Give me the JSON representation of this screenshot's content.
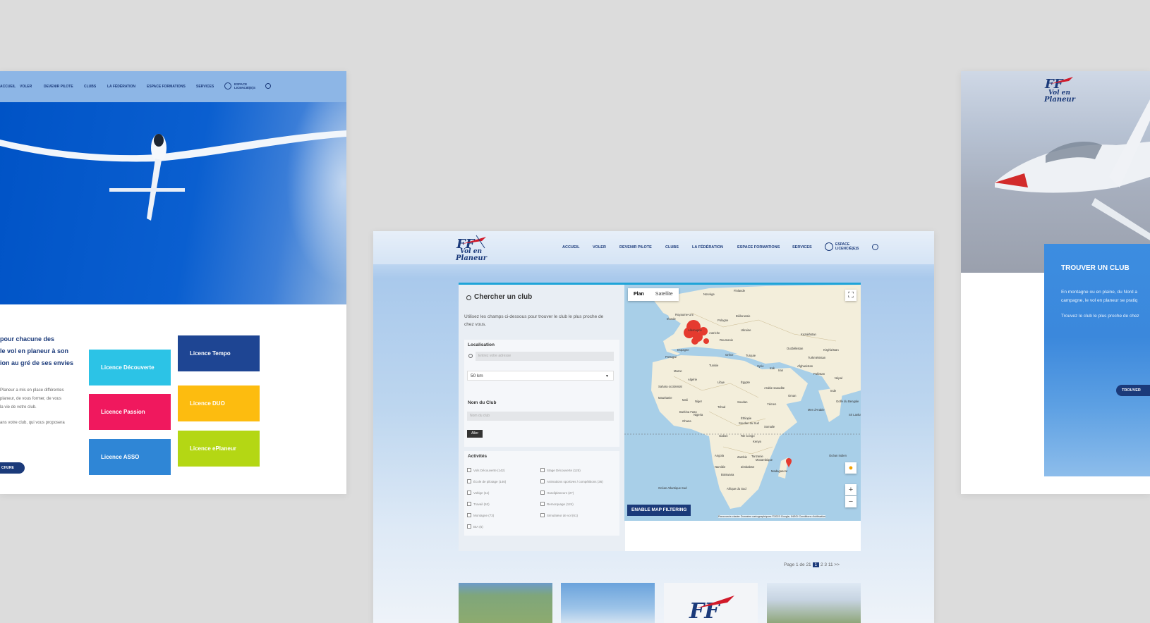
{
  "left": {
    "nav": [
      "ACCUEIL",
      "VOLER",
      "DEVENIR PILOTE",
      "CLUBS",
      "LA FÉDÉRATION",
      "ESPACE FORMATIONS",
      "SERVICES",
      "ESPACE LICENCIÉ(E)S"
    ],
    "intro_lines": [
      "pour chacune des",
      "le vol en planeur à son",
      "ion au gré de ses envies"
    ],
    "small_lines": [
      "Planeur a mis en place différentes",
      "planeur, de vous former, de vous",
      "la vie de votre club.",
      "ans votre club, qui vous proposera"
    ],
    "licences": [
      {
        "label": "Licence Découverte",
        "color": "#2cc3e6"
      },
      {
        "label": "Licence Tempo",
        "color": "#1e4593"
      },
      {
        "label": "Licence Passion",
        "color": "#f0185e"
      },
      {
        "label": "Licence DUO",
        "color": "#fdbc0f"
      },
      {
        "label": "Licence ASSO",
        "color": "#2f86d6"
      },
      {
        "label": "Licence ePlaneur",
        "color": "#b4d714"
      }
    ],
    "brochure": "CHURE"
  },
  "center": {
    "logo_text": [
      "Vol en",
      "Planeur"
    ],
    "menu": [
      "ACCUEIL",
      "VOLER",
      "DEVENIR PILOTE",
      "CLUBS",
      "LA FÉDÉRATION",
      "ESPACE FORMATIONS",
      "SERVICES",
      "ESPACE LICENCIÉ(E)S"
    ],
    "search": {
      "title": "Chercher un club",
      "desc": "Utilisez les champs ci-dessous pour trouver le club le plus proche de chez vous.",
      "localisation_label": "Localisation",
      "localisation_placeholder": "Entrez votre adresse",
      "radius": "50 km",
      "club_label": "Nom du Club",
      "club_placeholder": "Nom du club",
      "go": "Aller",
      "activities_label": "Activités",
      "activities_left": [
        "Vols Découverte (142)",
        "École de pilotage (146)",
        "Voltige (11)",
        "Travail (62)",
        "Montagne (73)",
        "BIA (6)"
      ],
      "activities_right": [
        "Stage Découverte (125)",
        "Animations sportives / compétitions (36)",
        "Handiplaneurs (27)",
        "Remorquage (124)",
        "Simulateur de vol (61)"
      ]
    },
    "map": {
      "plan": "Plan",
      "satellite": "Satellite",
      "filter_btn": "ENABLE MAP FILTERING",
      "footer": "Raccourcis clavier   Données cartographiques ©2023 Google, INEGI   Conditions d'utilisation",
      "labels": [
        "Finlande",
        "Norvège",
        "Royaume-Uni",
        "Irlande",
        "Pologne",
        "Biélorussie",
        "Ukraine",
        "Allemagne",
        "Autriche",
        "Roumanie",
        "Kazakhstan",
        "Espagne",
        "Portugal",
        "Grèce",
        "Turquie",
        "Ouzbékistan",
        "Kirghizistan",
        "Turkménistan",
        "Maroc",
        "Algérie",
        "Libye",
        "Égypte",
        "Syrie",
        "Irak",
        "Iran",
        "Afghanistan",
        "Pakistan",
        "Népal",
        "Inde",
        "Sahara occidental",
        "Mauritanie",
        "Mali",
        "Niger",
        "Tchad",
        "Soudan",
        "Arabie saoudite",
        "Oman",
        "Yémen",
        "Burkina Faso",
        "Nigeria",
        "Ghana",
        "Éthiopie",
        "Somalie",
        "Soudan du Sud",
        "Gabon",
        "RD Congo",
        "Kenya",
        "Tanzanie",
        "Angola",
        "Zambie",
        "Mozambique",
        "Namibie",
        "Zimbabwe",
        "Botswana",
        "Madagascar",
        "Afrique du Sud",
        "Tunisie",
        "Mer d'Arabie",
        "Océan Indien",
        "Océan Atlantique Sud",
        "Golfe du Bengale",
        "Sri Lanka"
      ]
    },
    "pagination": {
      "label": "Page 1 de 21",
      "current": "1",
      "pages": [
        "2",
        "3",
        "11",
        ">>"
      ]
    }
  },
  "right": {
    "logo_text": [
      "Vol en",
      "Planeur"
    ],
    "title": "TROUVER UN CLUB",
    "lines": [
      "En montagne ou en plaine, du Nord a",
      "campagne, le vol en planeur se pratiq",
      "Trouvez le club le plus proche de chez"
    ],
    "pill": "TROUVER"
  }
}
